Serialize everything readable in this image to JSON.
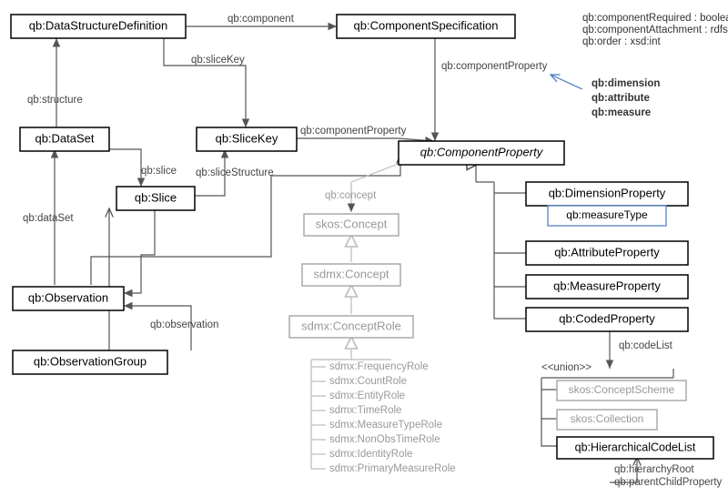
{
  "classes": {
    "dsd": "qb:DataStructureDefinition",
    "compSpec": "qb:ComponentSpecification",
    "dataset": "qb:DataSet",
    "sliceKey": "qb:SliceKey",
    "slice": "qb:Slice",
    "observation": "qb:Observation",
    "obsGroup": "qb:ObservationGroup",
    "compProp": "qb:ComponentProperty",
    "dimProp": "qb:DimensionProperty",
    "measType": "qb:measureType",
    "attrProp": "qb:AttributeProperty",
    "measProp": "qb:MeasureProperty",
    "codedProp": "qb:CodedProperty",
    "hierCodeList": "qb:HierarchicalCodeList",
    "skosConcept": "skos:Concept",
    "sdmxConcept": "sdmx:Concept",
    "sdmxConceptRole": "sdmx:ConceptRole",
    "skosConceptScheme": "skos:ConceptScheme",
    "skosCollection": "skos:Collection"
  },
  "edges": {
    "component": "qb:component",
    "structure": "qb:structure",
    "sliceKeyE": "qb:sliceKey",
    "componentProperty": "qb:componentProperty",
    "sliceE": "qb:slice",
    "sliceStructure": "qb:sliceStructure",
    "dataSetE": "qb:dataSet",
    "observationE": "qb:observation",
    "concept": "qb:concept",
    "codeList": "qb:codeList",
    "union": "<<union>>",
    "hierarchyRoot": "qb:hierarchyRoot",
    "parentChildProperty": "qb:parentChildProperty"
  },
  "compSpecAttrs": {
    "l1": "qb:componentRequired : boolean",
    "l2": "qb:componentAttachment : rdfs:Class",
    "l3": "qb:order : xsd:int"
  },
  "compPropKinds": {
    "k1": "qb:dimension",
    "k2": "qb:attribute",
    "k3": "qb:measure"
  },
  "roles": {
    "r1": "sdmx:FrequencyRole",
    "r2": "sdmx:CountRole",
    "r3": "sdmx:EntityRole",
    "r4": "sdmx:TimeRole",
    "r5": "sdmx:MeasureTypeRole",
    "r6": "sdmx:NonObsTimeRole",
    "r7": "sdmx:IdentityRole",
    "r8": "sdmx:PrimaryMeasureRole"
  }
}
